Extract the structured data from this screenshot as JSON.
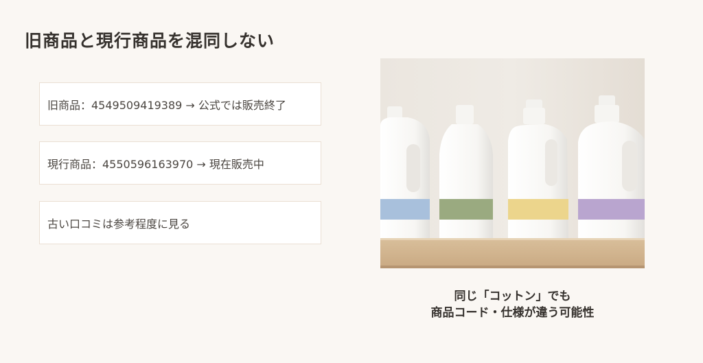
{
  "heading": "旧商品と現行商品を混同しない",
  "points": [
    "旧商品：4549509419389 → 公式では販売終了",
    "現行商品：4550596163970 → 現在販売中",
    "古い口コミは参考程度に見る"
  ],
  "caption": {
    "line1": "同じ「コットン」でも",
    "line2": "商品コード・仕様が違う可能性"
  },
  "photo": {
    "bottle_band_colors": [
      "#a8c0dc",
      "#9aaa80",
      "#ecd58c",
      "#b9a5cf"
    ]
  }
}
